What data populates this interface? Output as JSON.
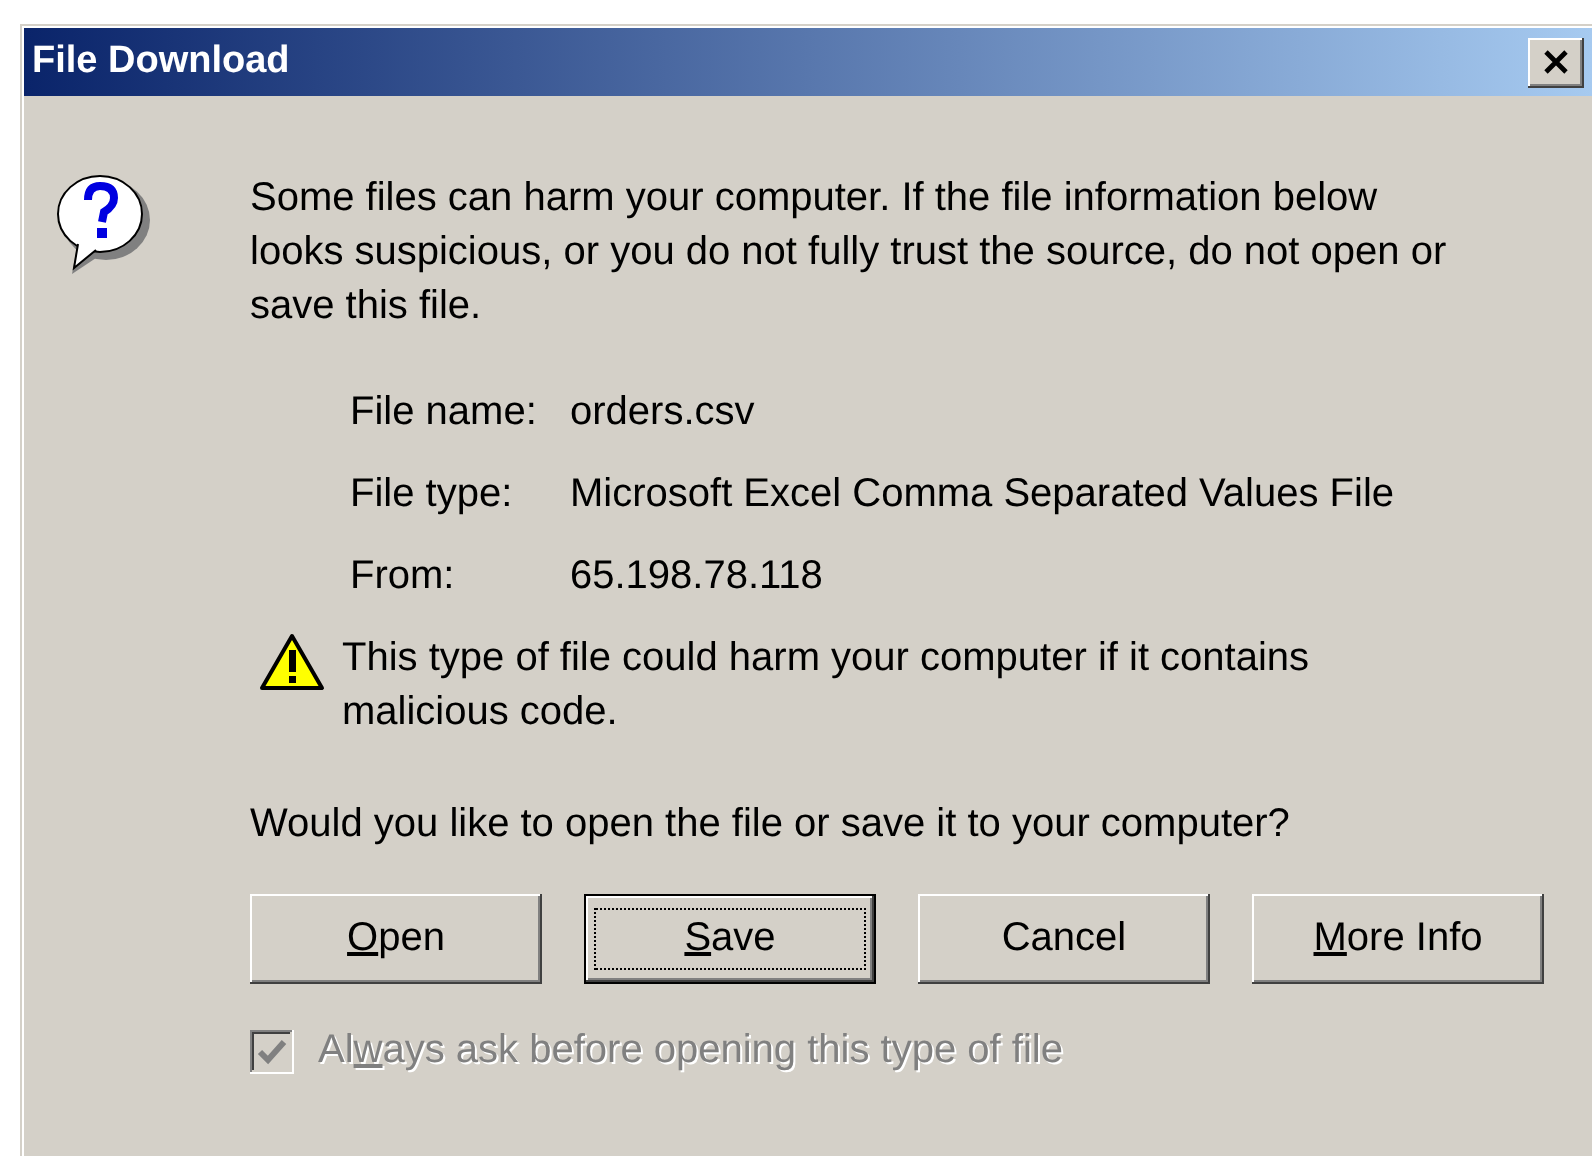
{
  "window": {
    "title": "File Download"
  },
  "message": "Some files can harm your computer. If the file information below looks suspicious, or you do not fully trust the source, do not open or save this file.",
  "details": [
    {
      "label": "File name:",
      "value": "orders.csv"
    },
    {
      "label": "File type:",
      "value": "Microsoft Excel Comma Separated Values File"
    },
    {
      "label": "From:",
      "value": "65.198.78.118"
    }
  ],
  "warning": "This type of file could harm your computer if it contains malicious code.",
  "question": "Would you like to open the file or save it to your computer?",
  "buttons": [
    {
      "label_parts": [
        {
          "text": "O",
          "underlined": true
        },
        {
          "text": "pen",
          "underlined": false
        }
      ],
      "focused": false
    },
    {
      "label_parts": [
        {
          "text": "S",
          "underlined": true
        },
        {
          "text": "ave",
          "underlined": false
        }
      ],
      "focused": true
    },
    {
      "label_parts": [
        {
          "text": "Cancel",
          "underlined": false
        }
      ],
      "focused": false
    },
    {
      "label_parts": [
        {
          "text": "M",
          "underlined": true
        },
        {
          "text": "ore Info",
          "underlined": false
        }
      ],
      "focused": false
    }
  ],
  "checkbox": {
    "label_parts": [
      {
        "text": "Al",
        "underlined": false
      },
      {
        "text": "w",
        "underlined": true
      },
      {
        "text": "ays ask before opening this type of file",
        "underlined": false
      }
    ],
    "checked": true,
    "disabled": true
  }
}
